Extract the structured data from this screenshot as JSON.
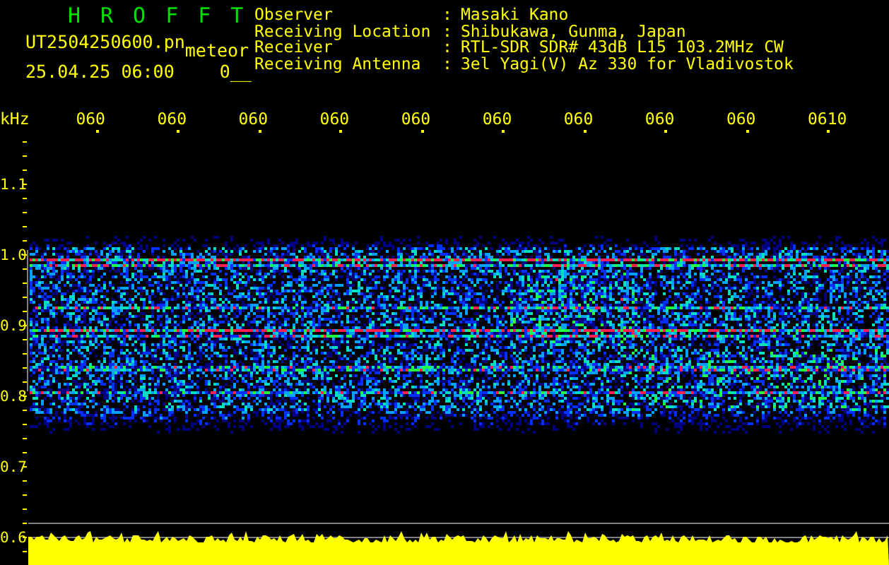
{
  "header": {
    "title": "HROFFT",
    "file_name": "UT2504250600.pn",
    "mode": "meteor",
    "timestamp": "25.04.25 06:00",
    "count": "0__"
  },
  "station": [
    {
      "label": "Observer",
      "separator": ":",
      "value": "Masaki Kano"
    },
    {
      "label": "Receiving Location",
      "separator": ":",
      "value": "Shibukawa, Gunma, Japan"
    },
    {
      "label": "Receiver",
      "separator": ":",
      "value": "RTL-SDR SDR# 43dB L15 103.2MHz CW"
    },
    {
      "label": "Receiving Antenna",
      "separator": ":",
      "value": "3el Yagi(V) Az 330 for Vladivostok"
    }
  ],
  "time_axis": {
    "unit": "kHz",
    "labels": [
      "060",
      "060",
      "060",
      "060",
      "060",
      "060",
      "060",
      "060",
      "060",
      "0610"
    ]
  },
  "frequency_axis": {
    "labels": [
      "1.1",
      "1.0",
      "0.9",
      "0.8",
      "0.7",
      "0.6"
    ]
  }
}
